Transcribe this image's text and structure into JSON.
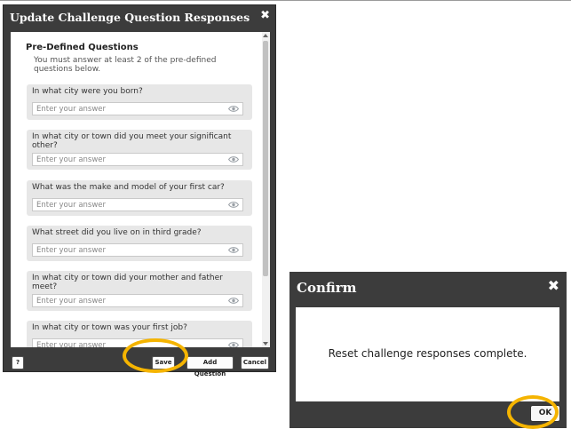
{
  "update_dialog": {
    "title": "Update Challenge Question Responses",
    "close_glyph": "✖",
    "section_heading": "Pre-Defined Questions",
    "instruction": "You must answer at least 2 of the pre-defined questions below.",
    "answer_placeholder": "Enter your answer",
    "questions": [
      {
        "label": "In what city were you born?",
        "value": ""
      },
      {
        "label": "In what city or town did you meet your significant other?",
        "value": ""
      },
      {
        "label": "What was the make and model of your first car?",
        "value": ""
      },
      {
        "label": "What street did you live on in third grade?",
        "value": ""
      },
      {
        "label": "In what city or town did your mother and father meet?",
        "value": ""
      },
      {
        "label": "In what city or town was your first job?",
        "value": ""
      }
    ],
    "buttons": {
      "help": "?",
      "save": "Save",
      "add_question": "Add Question",
      "cancel": "Cancel"
    }
  },
  "confirm_dialog": {
    "title": "Confirm",
    "close_glyph": "✖",
    "message": "Reset challenge responses complete.",
    "ok": "OK"
  },
  "icons": {
    "reveal": "eye-icon",
    "close": "close-icon"
  },
  "colors": {
    "dialog_bg": "#3c3c3c",
    "card_bg": "#e7e7e7",
    "highlight": "#f5b400",
    "eye_icon": "#9aa0a6"
  }
}
